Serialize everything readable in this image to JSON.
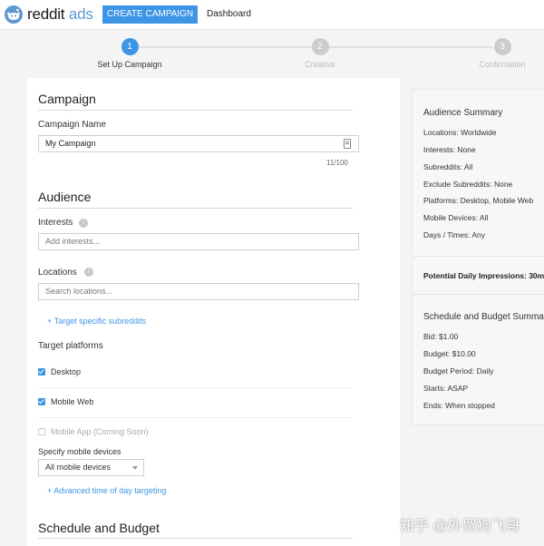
{
  "header": {
    "logo_text_main": "reddit",
    "logo_text_ads": "ads",
    "create_campaign_label": "CREATE CAMPAIGN",
    "dashboard_label": "Dashboard"
  },
  "stepper": [
    {
      "number": "1",
      "label": "Set Up Campaign",
      "active": true
    },
    {
      "number": "2",
      "label": "Creative",
      "active": false
    },
    {
      "number": "3",
      "label": "Confirmation",
      "active": false
    }
  ],
  "campaign": {
    "section_title": "Campaign",
    "name_label": "Campaign Name",
    "name_value": "My Campaign",
    "char_count": "11/100"
  },
  "audience": {
    "section_title": "Audience",
    "interests_label": "Interests",
    "interests_placeholder": "Add interests...",
    "locations_label": "Locations",
    "locations_placeholder": "Search locations...",
    "subreddits_link": "+ Target specific subreddits",
    "platforms_label": "Target platforms",
    "platforms": [
      {
        "label": "Desktop",
        "checked": true,
        "disabled": false
      },
      {
        "label": "Mobile Web",
        "checked": true,
        "disabled": false
      },
      {
        "label": "Mobile App (Coming Soon)",
        "checked": false,
        "disabled": true
      }
    ],
    "devices_label": "Specify mobile devices",
    "devices_value": "All mobile devices",
    "time_link": "+ Advanced time of day targeting"
  },
  "schedule": {
    "section_title": "Schedule and Budget"
  },
  "summary": {
    "audience_title": "Audience Summary",
    "audience_items": [
      "Locations: Worldwide",
      "Interests: None",
      "Subreddits: All",
      "Exclude Subreddits: None",
      "Platforms: Desktop, Mobile Web",
      "Mobile Devices: All",
      "Days / Times: Any"
    ],
    "impressions": "Potential Daily Impressions: 30m",
    "schedule_title": "Schedule and Budget Summary",
    "schedule_items": [
      "Bid: $1.00",
      "Budget: $10.00",
      "Budget Period: Daily",
      "Starts: ASAP",
      "Ends: When stopped"
    ]
  },
  "watermark": "知乎 @外贸狗飞哥",
  "colors": {
    "accent": "#3d95e6",
    "page_bg": "#f4f4f4",
    "summary_bg": "#f7f7f7"
  }
}
